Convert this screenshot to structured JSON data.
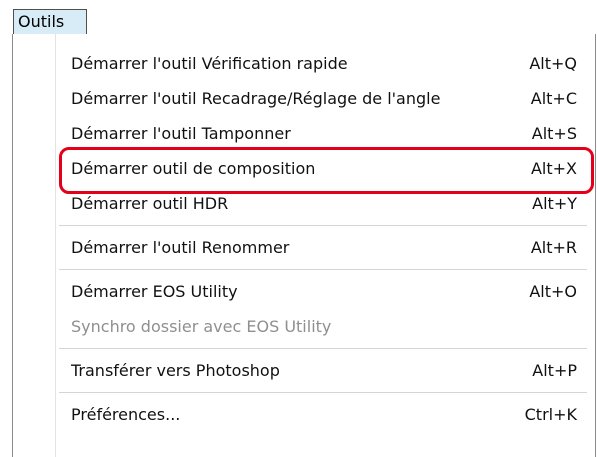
{
  "menubar": {
    "menu_title": "Outils"
  },
  "menu": {
    "group1": [
      {
        "label": "Démarrer l'outil Vérification rapide",
        "shortcut": "Alt+Q"
      },
      {
        "label": "Démarrer l'outil Recadrage/Réglage de l'angle",
        "shortcut": "Alt+C"
      },
      {
        "label": "Démarrer l'outil Tamponner",
        "shortcut": "Alt+S"
      },
      {
        "label": "Démarrer outil de composition",
        "shortcut": "Alt+X"
      },
      {
        "label": "Démarrer outil HDR",
        "shortcut": "Alt+Y"
      }
    ],
    "group2": [
      {
        "label": "Démarrer l'outil Renommer",
        "shortcut": "Alt+R"
      }
    ],
    "group3": [
      {
        "label": "Démarrer EOS Utility",
        "shortcut": "Alt+O"
      },
      {
        "label": "Synchro dossier avec EOS Utility",
        "shortcut": "",
        "disabled": true
      }
    ],
    "group4": [
      {
        "label": "Transférer vers Photoshop",
        "shortcut": "Alt+P"
      }
    ],
    "group5": [
      {
        "label": "Préférences...",
        "shortcut": "Ctrl+K"
      }
    ]
  },
  "annotation": {
    "highlight_color": "#e2001a",
    "highlighted_item": "Démarrer outil de composition"
  }
}
